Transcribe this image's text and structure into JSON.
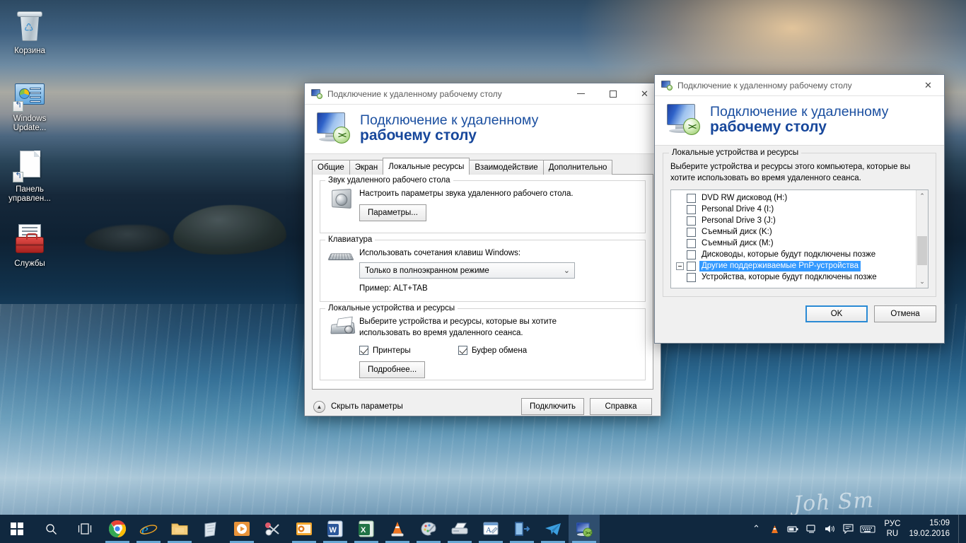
{
  "desktop": {
    "icons": [
      {
        "name": "recycle-bin",
        "label": "Корзина"
      },
      {
        "name": "windows-update",
        "label": "Windows Update..."
      },
      {
        "name": "control-panel",
        "label": "Панель управлен..."
      },
      {
        "name": "services",
        "label": "Службы"
      }
    ],
    "signature": "Joh Sm"
  },
  "main_window": {
    "titlebar": {
      "title": "Подключение к удаленному рабочему столу",
      "minimize": "—",
      "maximize": "▢",
      "close": "✕"
    },
    "banner": {
      "line1": "Подключение к удаленному",
      "line2": "рабочему столу",
      "logo_badge": "><"
    },
    "tabs": [
      {
        "label": "Общие",
        "active": false
      },
      {
        "label": "Экран",
        "active": false
      },
      {
        "label": "Локальные ресурсы",
        "active": true
      },
      {
        "label": "Взаимодействие",
        "active": false
      },
      {
        "label": "Дополнительно",
        "active": false
      }
    ],
    "audio_group": {
      "legend": "Звук удаленного рабочего стола",
      "description": "Настроить параметры звука удаленного рабочего стола.",
      "settings_button": "Параметры..."
    },
    "keyboard_group": {
      "legend": "Клавиатура",
      "description": "Использовать сочетания клавиш Windows:",
      "combo_value": "Только в полноэкранном режиме",
      "combo_chevron": "⌄",
      "example": "Пример: ALT+TAB"
    },
    "devices_group": {
      "legend": "Локальные устройства и ресурсы",
      "description_l1": "Выберите устройства и ресурсы, которые вы хотите",
      "description_l2": "использовать во время удаленного сеанса.",
      "checkbox_printers": "Принтеры",
      "checkbox_printers_checked": true,
      "checkbox_clipboard": "Буфер обмена",
      "checkbox_clipboard_checked": true,
      "more_button": "Подробнее..."
    },
    "footer": {
      "collapse_label": "Скрыть параметры",
      "collapse_glyph": "▲",
      "connect_button": "Подключить",
      "help_button": "Справка"
    }
  },
  "devices_dialog": {
    "titlebar": {
      "title": "Подключение к удаленному рабочему столу",
      "close": "✕"
    },
    "banner": {
      "line1": "Подключение к удаленному",
      "line2": "рабочему столу",
      "logo_badge": "><"
    },
    "group": {
      "legend": "Локальные устройства и ресурсы",
      "description_l1": "Выберите устройства и ресурсы этого компьютера, которые вы",
      "description_l2": "хотите использовать во время удаленного сеанса."
    },
    "tree": [
      {
        "label": "DVD RW дисковод (H:)",
        "level": 1,
        "checked": false,
        "selected": false,
        "expander": false
      },
      {
        "label": "Personal Drive 4 (I:)",
        "level": 1,
        "checked": false,
        "selected": false,
        "expander": false
      },
      {
        "label": "Personal Drive 3 (J:)",
        "level": 1,
        "checked": false,
        "selected": false,
        "expander": false
      },
      {
        "label": "Съемный диск (K:)",
        "level": 1,
        "checked": false,
        "selected": false,
        "expander": false
      },
      {
        "label": "Съемный диск (M:)",
        "level": 1,
        "checked": false,
        "selected": false,
        "expander": false
      },
      {
        "label": "Дисководы, которые будут подключены позже",
        "level": 1,
        "checked": false,
        "selected": false,
        "expander": false
      },
      {
        "label": "Другие поддерживаемые PnP-устройства",
        "level": 0,
        "checked": false,
        "selected": true,
        "expander": true
      },
      {
        "label": "Устройства, которые будут подключены позже",
        "level": 1,
        "checked": false,
        "selected": false,
        "expander": false
      }
    ],
    "scrollbar": {
      "up": "⌃",
      "down": "⌄"
    },
    "buttons": {
      "ok": "OK",
      "cancel": "Отмена"
    }
  },
  "taskbar": {
    "start_name": "start-button",
    "search_glyph": "⌕",
    "taskview_glyph": "❐",
    "apps": [
      {
        "name": "chrome",
        "running": true
      },
      {
        "name": "internet-explorer",
        "running": true
      },
      {
        "name": "file-explorer",
        "running": true
      },
      {
        "name": "sticky-notes",
        "running": false
      },
      {
        "name": "media-player",
        "running": true
      },
      {
        "name": "snipping-tool",
        "running": false
      },
      {
        "name": "outlook",
        "running": true
      },
      {
        "name": "word",
        "running": true
      },
      {
        "name": "excel",
        "running": true
      },
      {
        "name": "vlc",
        "running": true
      },
      {
        "name": "paint",
        "running": true
      },
      {
        "name": "scanner",
        "running": true
      },
      {
        "name": "wordpad",
        "running": true
      },
      {
        "name": "remote-logon",
        "running": true
      },
      {
        "name": "telegram",
        "running": true
      },
      {
        "name": "remote-desktop",
        "running": true,
        "active": true
      }
    ],
    "tray": {
      "chevron": "⌃",
      "icons": [
        "vlc-tray-icon",
        "battery-icon",
        "network-icon",
        "volume-icon",
        "action-center-icon",
        "keyboard-layout-icon"
      ],
      "lang_l1": "РУС",
      "lang_l2": "RU",
      "time": "15:09",
      "date": "19.02.2016"
    }
  },
  "colors": {
    "accent_blue": "#17479b",
    "selection_blue": "#3399ff",
    "taskbar": "#10283f",
    "default_button_border": "#2a8ad4"
  }
}
